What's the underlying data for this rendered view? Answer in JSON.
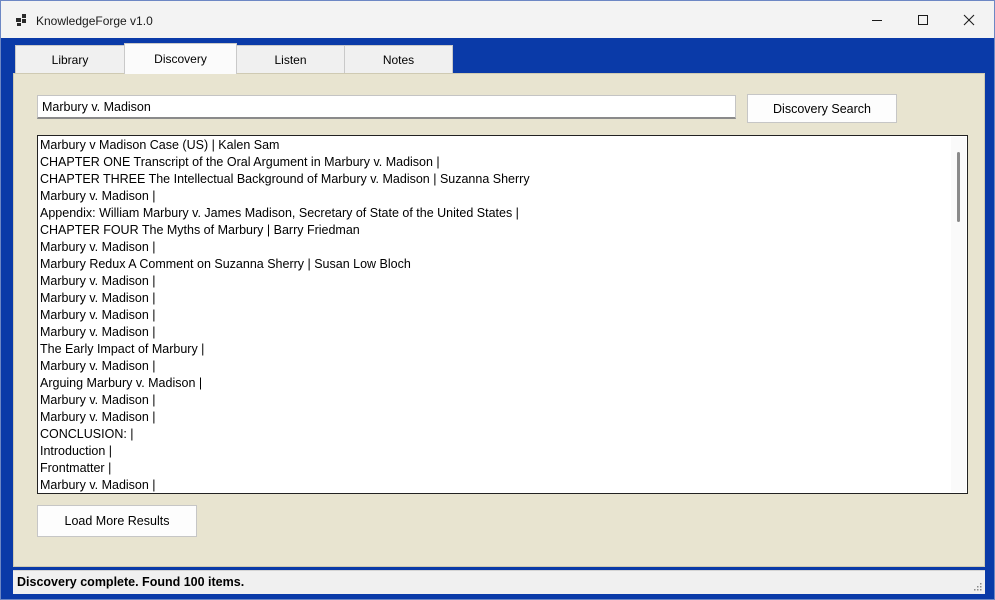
{
  "window": {
    "title": "KnowledgeForge v1.0",
    "icon": "app-windows-icon",
    "controls": {
      "minimize": "minimize-icon",
      "maximize": "maximize-icon",
      "close": "close-icon"
    }
  },
  "tabs": [
    {
      "label": "Library",
      "active": false
    },
    {
      "label": "Discovery",
      "active": true
    },
    {
      "label": "Listen",
      "active": false
    },
    {
      "label": "Notes",
      "active": false
    }
  ],
  "search": {
    "value": "Marbury v. Madison",
    "button_label": "Discovery Search"
  },
  "results": [
    "Marbury v Madison Case (US) | Kalen Sam",
    "CHAPTER ONE Transcript of the Oral Argument in Marbury v. Madison |",
    "CHAPTER THREE The Intellectual Background of Marbury v. Madison | Suzanna Sherry",
    "Marbury v. Madison |",
    "Appendix: William Marbury v. James Madison, Secretary of State of the United States |",
    "CHAPTER FOUR The Myths of Marbury | Barry Friedman",
    "Marbury v. Madison |",
    "Marbury Redux A Comment on Suzanna Sherry | Susan Low Bloch",
    "Marbury v. Madison |",
    "Marbury v. Madison |",
    "Marbury v. Madison |",
    "Marbury v. Madison |",
    "The Early Impact of Marbury |",
    "Marbury v. Madison |",
    "Arguing Marbury v. Madison |",
    "Marbury v. Madison |",
    "Marbury v. Madison |",
    "CONCLUSION: |",
    "Introduction |",
    "Frontmatter |",
    "Marbury v. Madison |"
  ],
  "load_more_label": "Load More Results",
  "status": "Discovery complete. Found 100 items.",
  "colors": {
    "frame": "#0a3aa8",
    "panel": "#e8e4d0",
    "titlebar": "#f3f3f3"
  }
}
